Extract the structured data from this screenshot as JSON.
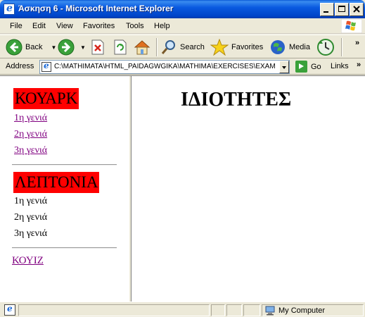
{
  "window": {
    "title": "Άσκηση 6 - Microsoft Internet Explorer"
  },
  "menubar": {
    "items": [
      "File",
      "Edit",
      "View",
      "Favorites",
      "Tools",
      "Help"
    ]
  },
  "toolbar": {
    "back_label": "Back",
    "search_label": "Search",
    "favorites_label": "Favorites",
    "media_label": "Media"
  },
  "addressbar": {
    "label": "Address",
    "value": "C:\\MATHIMATA\\HTML_PAIDAGWGIKA\\MATHIMA\\EXERCISES\\EXAM",
    "go_label": "Go",
    "links_label": "Links"
  },
  "nav": {
    "section1_title": "ΚΟΥΑΡΚ",
    "section1_items": [
      "1η γενιά",
      "2η γενιά",
      "3η γενιά"
    ],
    "section2_title": "ΛΕΠΤΟΝΙΑ",
    "section2_items": [
      "1η γενιά",
      "2η γενιά",
      "3η γενιά"
    ],
    "quiz_label": "ΚΟΥΙΖ"
  },
  "main": {
    "heading": "ΙΔΙΟΤΗΤΕΣ"
  },
  "statusbar": {
    "zone_label": "My Computer"
  },
  "colors": {
    "titlebar": "#0a5ae0",
    "section_bg": "#ff0000",
    "visited_link": "#800080"
  }
}
